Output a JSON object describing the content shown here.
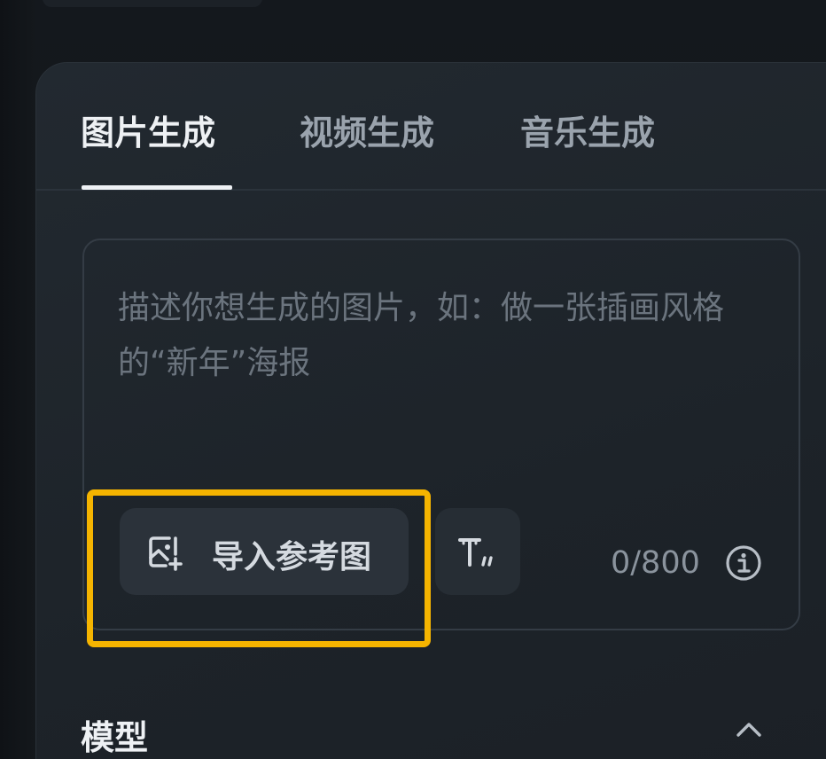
{
  "tabs": [
    {
      "label": "图片生成",
      "active": true
    },
    {
      "label": "视频生成",
      "active": false
    },
    {
      "label": "音乐生成",
      "active": false
    }
  ],
  "prompt": {
    "value": "",
    "placeholder": "描述你想生成的图片，如：做一张插画风格的“新年”海报"
  },
  "toolbar": {
    "import_label": "导入参考图",
    "import_icon": "image-add-icon",
    "text_style_icon": "text-style-icon",
    "counter": "0/800",
    "info_icon": "info-icon"
  },
  "section": {
    "title": "模型",
    "toggle_icon": "chevron-up-icon"
  },
  "colors": {
    "highlight": "#f5b400",
    "background": "#111418",
    "panel": "#1f252b"
  }
}
